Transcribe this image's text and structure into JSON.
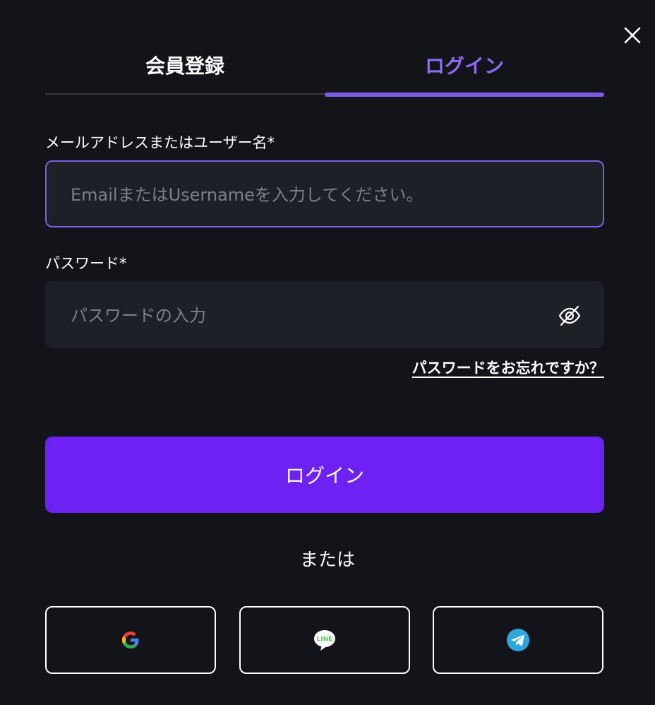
{
  "tabs": {
    "signup": "会員登録",
    "login": "ログイン",
    "active": "login"
  },
  "email": {
    "label": "メールアドレスまたはユーザー名*",
    "placeholder": "EmailまたはUsernameを入力してください。",
    "value": ""
  },
  "password": {
    "label": "パスワード*",
    "placeholder": "パスワードの入力",
    "value": ""
  },
  "forgot_link": "パスワードをお忘れですか？",
  "login_button": "ログイン",
  "divider_text": "または",
  "social": [
    {
      "name": "google",
      "icon": "google-icon"
    },
    {
      "name": "line",
      "icon": "line-icon",
      "logo_text": "LINE"
    },
    {
      "name": "telegram",
      "icon": "telegram-icon"
    }
  ],
  "colors": {
    "background": "#131419",
    "accent": "#6d21f2",
    "tab_active": "#8b6cf0",
    "input_bg": "#1e2027",
    "focus_border": "#7a62e6",
    "line_green": "#4cc764",
    "telegram_blue": "#2ea6db"
  }
}
